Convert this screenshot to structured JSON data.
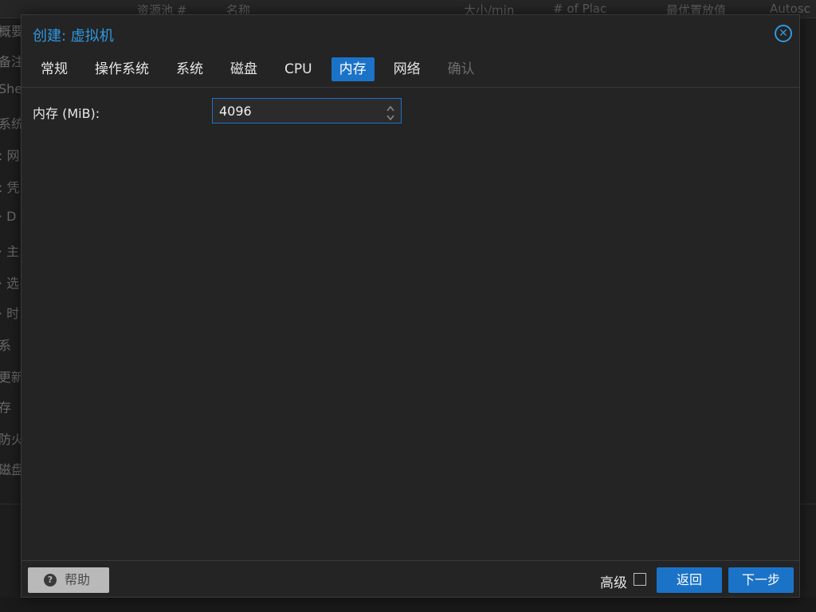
{
  "background": {
    "columns": [
      "资源池 #",
      "名称",
      "大小/min",
      "# of Plac",
      "最优置放值",
      "Autosc"
    ],
    "sidebar": [
      "概要",
      "备注",
      "Shel",
      "系统",
      ": 网",
      ": 凭",
      "· D",
      "· 主",
      "· 选",
      "· 时",
      "系",
      "更新",
      "存",
      "防火",
      "磁盘"
    ]
  },
  "dialog": {
    "title": "创建: 虚拟机",
    "tabs": [
      {
        "label": "常规",
        "state": "normal"
      },
      {
        "label": "操作系统",
        "state": "normal"
      },
      {
        "label": "系统",
        "state": "normal"
      },
      {
        "label": "磁盘",
        "state": "normal"
      },
      {
        "label": "CPU",
        "state": "normal"
      },
      {
        "label": "内存",
        "state": "active"
      },
      {
        "label": "网络",
        "state": "normal"
      },
      {
        "label": "确认",
        "state": "disabled"
      }
    ],
    "memory": {
      "label": "内存 (MiB):",
      "value": "4096"
    },
    "footer": {
      "help_label": "帮助",
      "help_icon": "question-circle-icon",
      "advanced_label": "高级",
      "advanced_checked": false,
      "back_label": "返回",
      "next_label": "下一步"
    }
  },
  "colors": {
    "accent": "#1b73c8",
    "title": "#2f97e0",
    "dialog_bg": "#242424"
  }
}
